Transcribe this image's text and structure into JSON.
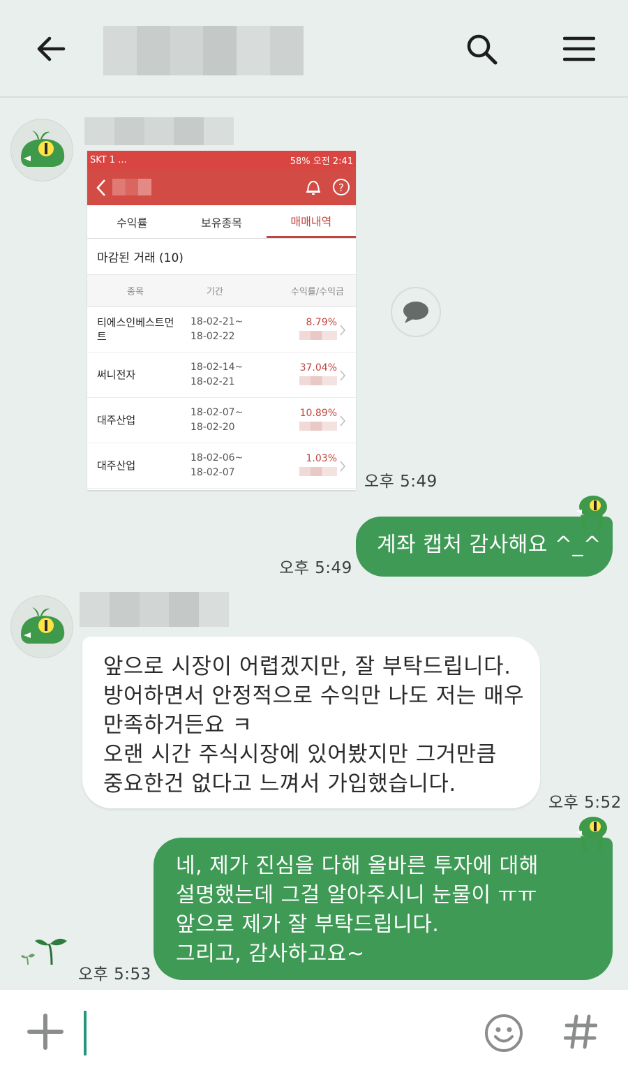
{
  "header": {
    "title_redacted": true
  },
  "messages": [
    {
      "type": "image",
      "time": "오후 5:49",
      "screenshot": {
        "statusbar": {
          "carrier": "SKT",
          "battery": "58%",
          "clock": "오전 2:41",
          "extra": "1 ..."
        },
        "tabs": [
          "수익률",
          "보유종목",
          "매매내역"
        ],
        "active_tab": "매매내역",
        "section": "마감된 거래 (10)",
        "columns": [
          "종목",
          "기간",
          "수익률/수익금"
        ],
        "rows": [
          {
            "name1": "티에스인베스트먼",
            "name2": "트",
            "from": "18-02-21~",
            "to": "18-02-22",
            "rate": "8.79%"
          },
          {
            "name1": "써니전자",
            "name2": "",
            "from": "18-02-14~",
            "to": "18-02-21",
            "rate": "37.04%"
          },
          {
            "name1": "대주산업",
            "name2": "",
            "from": "18-02-07~",
            "to": "18-02-20",
            "rate": "10.89%"
          },
          {
            "name1": "대주산업",
            "name2": "",
            "from": "18-02-06~",
            "to": "18-02-07",
            "rate": "1.03%"
          }
        ]
      }
    },
    {
      "type": "sent",
      "time": "오후 5:49",
      "lines": [
        "계좌 캡처 감사해요 ^_^"
      ]
    },
    {
      "type": "received",
      "time": "오후 5:52",
      "lines": [
        "앞으로 시장이 어렵겠지만, 잘 부탁드립니다.",
        "방어하면서 안정적으로 수익만 나도 저는 매우",
        "만족하거든요 ㅋ",
        "오랜 시간 주식시장에 있어봤지만 그거만큼",
        "중요한건 없다고 느껴서 가입했습니다."
      ]
    },
    {
      "type": "sent",
      "time": "오후 5:53",
      "lines": [
        "네, 제가 진심을 다해 올바른 투자에 대해",
        "설명했는데 그걸 알아주시니 눈물이 ㅠㅠ",
        "앞으로 제가 잘 부탁드립니다.",
        "그리고, 감사하고요~"
      ]
    }
  ],
  "composer": {
    "value": ""
  },
  "colors": {
    "sent_bubble": "#3f9a56",
    "background": "#e9efec",
    "accent": "#25957c",
    "stock_red": "#d34b45"
  }
}
